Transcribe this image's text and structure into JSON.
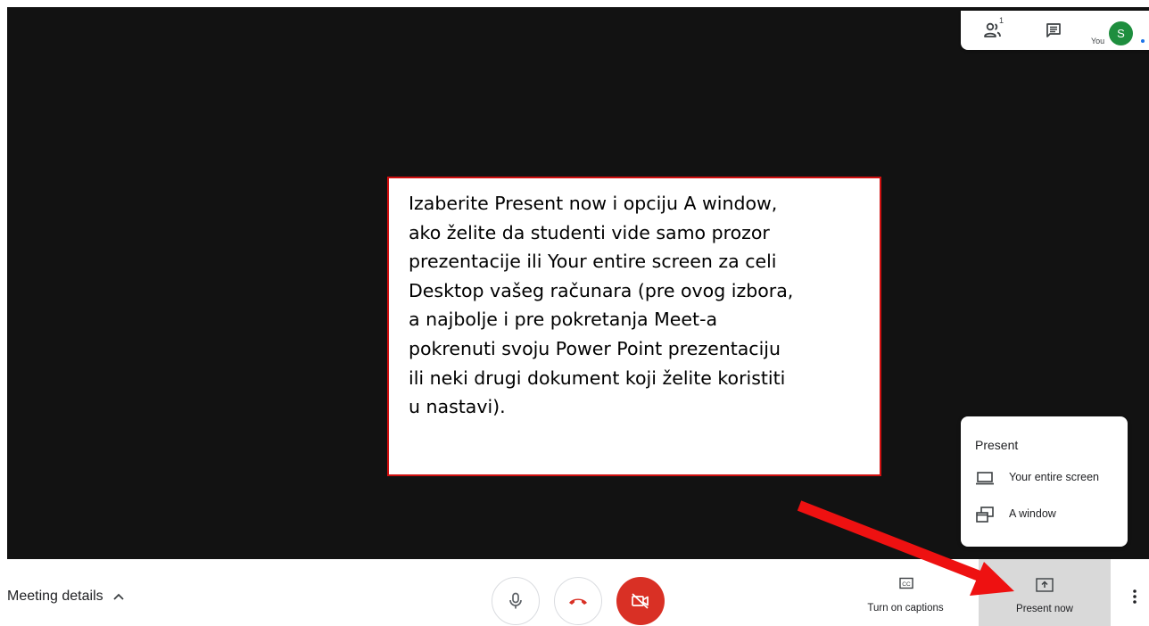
{
  "top_card": {
    "people_count": "1",
    "you_label": "You",
    "avatar_initial": "S"
  },
  "callout": {
    "text": "Izaberite Present now i opciju A window,\nako želite da studenti vide samo prozor\nprezentacije ili Your entire screen za celi\nDesktop vašeg računara (pre ovog izbora,\na najbolje i pre pokretanja Meet-a\npokrenuti svoju Power Point prezentaciju\nili neki drugi dokument koji želite koristiti\nu nastavi).",
    "border_color": "#d01010"
  },
  "present_menu": {
    "title": "Present",
    "items": [
      {
        "label": "Your entire screen",
        "icon": "laptop-icon"
      },
      {
        "label": "A window",
        "icon": "window-icon"
      }
    ]
  },
  "bottom_bar": {
    "meeting_details_label": "Meeting details",
    "captions_label": "Turn on captions",
    "present_now_label": "Present now"
  },
  "colors": {
    "stage_background": "#121212",
    "camera_off_red": "#d93025",
    "hangup_red": "#d93025",
    "avatar_green": "#1e8e3e",
    "annotation_arrow": "#ee1111"
  }
}
